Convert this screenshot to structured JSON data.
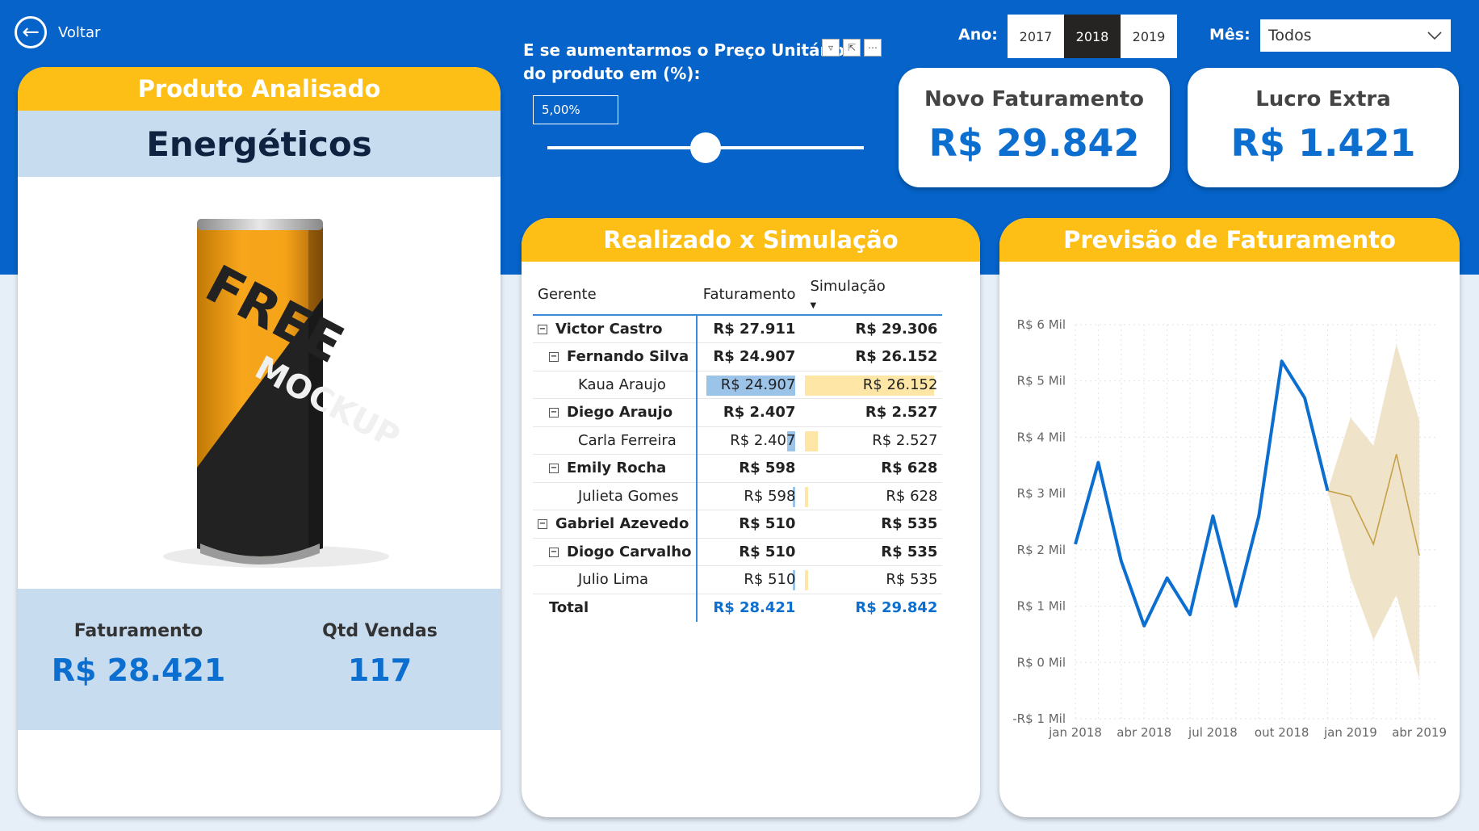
{
  "nav": {
    "back_label": "Voltar"
  },
  "product": {
    "header": "Produto Analisado",
    "name": "Energéticos",
    "can_text_1": "FREE",
    "can_text_2": "MOCKUP",
    "faturamento_label": "Faturamento",
    "faturamento_value": "R$ 28.421",
    "qtd_label": "Qtd Vendas",
    "qtd_value": "117"
  },
  "slicer": {
    "question": "E se aumentarmos o Preço Unitário do produto em (%):",
    "value": "5,00%",
    "level": 0.5
  },
  "filters": {
    "ano_label": "Ano:",
    "years": [
      "2017",
      "2018",
      "2019"
    ],
    "selected_year": "2018",
    "mes_label": "Mês:",
    "mes_value": "Todos"
  },
  "kpis": {
    "novo_label": "Novo Faturamento",
    "novo_value": "R$ 29.842",
    "lucro_label": "Lucro Extra",
    "lucro_value": "R$ 1.421"
  },
  "table": {
    "title": "Realizado x Simulação",
    "headers": [
      "Gerente",
      "Faturamento",
      "Simulação"
    ],
    "rows": [
      {
        "name": "Victor Castro",
        "level": 0,
        "fat": "R$ 27.911",
        "sim": "R$ 29.306",
        "bold": true
      },
      {
        "name": "Fernando Silva",
        "level": 1,
        "fat": "R$ 24.907",
        "sim": "R$ 26.152",
        "bold": true
      },
      {
        "name": "Kaua Araujo",
        "level": 2,
        "fat": "R$ 24.907",
        "sim": "R$ 26.152",
        "bold": false
      },
      {
        "name": "Diego Araujo",
        "level": 1,
        "fat": "R$ 2.407",
        "sim": "R$ 2.527",
        "bold": true
      },
      {
        "name": "Carla Ferreira",
        "level": 2,
        "fat": "R$ 2.407",
        "sim": "R$ 2.527",
        "bold": false
      },
      {
        "name": "Emily Rocha",
        "level": 1,
        "fat": "R$ 598",
        "sim": "R$ 628",
        "bold": true
      },
      {
        "name": "Julieta Gomes",
        "level": 2,
        "fat": "R$ 598",
        "sim": "R$ 628",
        "bold": false
      },
      {
        "name": "Gabriel Azevedo",
        "level": 0,
        "fat": "R$ 510",
        "sim": "R$ 535",
        "bold": true
      },
      {
        "name": "Diogo Carvalho",
        "level": 1,
        "fat": "R$ 510",
        "sim": "R$ 535",
        "bold": true
      },
      {
        "name": "Julio Lima",
        "level": 2,
        "fat": "R$ 510",
        "sim": "R$ 535",
        "bold": false
      }
    ],
    "total": {
      "name": "Total",
      "fat": "R$ 28.421",
      "sim": "R$ 29.842"
    },
    "leaf_fat_values": [
      24907,
      2407,
      598,
      510
    ],
    "leaf_sim_values": [
      26152,
      2527,
      628,
      535
    ]
  },
  "chart_data": {
    "type": "line",
    "title": "Previsão de Faturamento",
    "ylabel": "",
    "xlabel": "",
    "ylim": [
      -1000,
      6000
    ],
    "y_ticks": [
      -1000,
      0,
      1000,
      2000,
      3000,
      4000,
      5000,
      6000
    ],
    "y_tick_labels": [
      "-R$ 1 Mil",
      "R$ 0 Mil",
      "R$ 1 Mil",
      "R$ 2 Mil",
      "R$ 3 Mil",
      "R$ 4 Mil",
      "R$ 5 Mil",
      "R$ 6 Mil"
    ],
    "x_tick_labels": [
      "jan 2018",
      "abr 2018",
      "jul 2018",
      "out 2018",
      "jan 2019",
      "abr 2019"
    ],
    "x_tick_months": [
      0,
      3,
      6,
      9,
      12,
      15
    ],
    "grid": true,
    "colors": {
      "actual": "#0c6fd0",
      "forecast": "#c6a04a",
      "band": "#ecdfc1"
    },
    "actual": {
      "months": [
        0,
        1,
        2,
        3,
        4,
        5,
        6,
        7,
        8,
        9,
        10,
        11
      ],
      "values": [
        2100,
        3550,
        1800,
        650,
        1500,
        850,
        2600,
        1000,
        2600,
        5350,
        4700,
        3050
      ]
    },
    "forecast": {
      "months": [
        11,
        12,
        13,
        14,
        15
      ],
      "values": [
        3050,
        2950,
        2100,
        3700,
        1900
      ],
      "upper": [
        3050,
        4350,
        3850,
        5650,
        4300
      ],
      "lower": [
        3050,
        1500,
        400,
        1200,
        -300
      ]
    }
  }
}
